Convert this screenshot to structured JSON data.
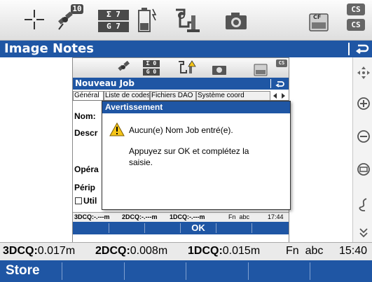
{
  "top_toolbar": {
    "sat_count": "10",
    "sigma_top": "Σ  7",
    "sigma_bottom": "G  7",
    "cs_top": "CS",
    "cs_bottom": "CS",
    "cf_label": "CF"
  },
  "app": {
    "title": "Image Notes"
  },
  "inner_window": {
    "mini_sigma_top": "Σ 0",
    "mini_sigma_bottom": "G 0",
    "mini_cs": "CS",
    "title": "Nouveau Job",
    "tabs": [
      "Général",
      "Liste de codes",
      "Fichiers DAO",
      "Système coord"
    ],
    "fields": [
      "Nom:",
      "Descr",
      "Opéra",
      "Périp",
      "Util"
    ],
    "status": {
      "dcq3": "3DCQ:-.---m",
      "dcq2": "2DCQ:-.---m",
      "dcq1": "1DCQ:-.---m",
      "mode": "Fn  abc",
      "time": "17:44"
    },
    "ok_label": "OK"
  },
  "dialog": {
    "title": "Avertissement",
    "message1": "Aucun(e) Nom Job entré(e).",
    "message2_line1": "Appuyez sur OK et complétez la",
    "message2_line2": "saisie."
  },
  "status_bar": {
    "dcq3_label": "3DCQ:",
    "dcq3_value": "0.017m",
    "dcq2_label": "2DCQ:",
    "dcq2_value": "0.008m",
    "dcq1_label": "1DCQ:",
    "dcq1_value": "0.015m",
    "mode": "Fn  abc",
    "time": "15:40"
  },
  "bottom_bar": {
    "store_label": "Store"
  },
  "colors": {
    "title_blue": "#1f56a4",
    "warning_yellow": "#f5c518"
  }
}
